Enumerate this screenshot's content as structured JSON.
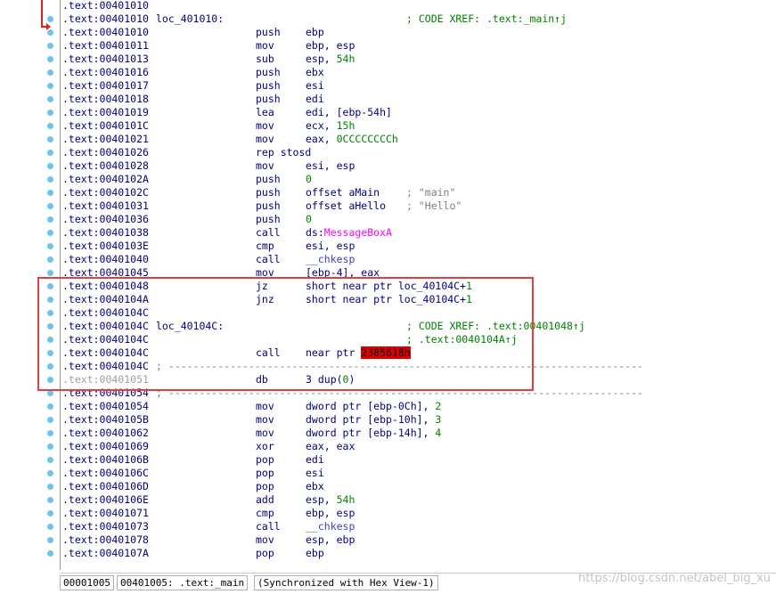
{
  "lines": [
    {
      "addr": ".text:00401010"
    },
    {
      "addr": ".text:00401010",
      "label": "loc_401010:",
      "comment": "; CODE XREF: .text:_main↑j"
    },
    {
      "addr": ".text:00401010",
      "mnem": "push",
      "ops": "ebp"
    },
    {
      "addr": ".text:00401011",
      "mnem": "mov",
      "ops": "ebp, esp"
    },
    {
      "addr": ".text:00401013",
      "mnem": "sub",
      "ops": "esp, ",
      "ops_num": "54h"
    },
    {
      "addr": ".text:00401016",
      "mnem": "push",
      "ops": "ebx"
    },
    {
      "addr": ".text:00401017",
      "mnem": "push",
      "ops": "esi"
    },
    {
      "addr": ".text:00401018",
      "mnem": "push",
      "ops": "edi"
    },
    {
      "addr": ".text:00401019",
      "mnem": "lea",
      "ops": "edi, [ebp-54h]"
    },
    {
      "addr": ".text:0040101C",
      "mnem": "mov",
      "ops": "ecx, ",
      "ops_num": "15h"
    },
    {
      "addr": ".text:00401021",
      "mnem": "mov",
      "ops": "eax, ",
      "ops_num": "0CCCCCCCCh"
    },
    {
      "addr": ".text:00401026",
      "mnem": "rep stosd"
    },
    {
      "addr": ".text:00401028",
      "mnem": "mov",
      "ops": "esi, esp"
    },
    {
      "addr": ".text:0040102A",
      "mnem": "push",
      "ops_num": "0"
    },
    {
      "addr": ".text:0040102C",
      "mnem": "push",
      "ops": "offset aMain",
      "str_comment": "; \"main\""
    },
    {
      "addr": ".text:00401031",
      "mnem": "push",
      "ops": "offset aHello",
      "str_comment": "; \"Hello\""
    },
    {
      "addr": ".text:00401036",
      "mnem": "push",
      "ops_num": "0"
    },
    {
      "addr": ".text:00401038",
      "mnem": "call",
      "ops": "ds:",
      "ops_imp": "MessageBoxA"
    },
    {
      "addr": ".text:0040103E",
      "mnem": "cmp",
      "ops": "esi, esp"
    },
    {
      "addr": ".text:00401040",
      "mnem": "call",
      "ops_lib": "__chkesp"
    },
    {
      "addr": ".text:00401045",
      "mnem": "mov",
      "ops": "[ebp-4], eax"
    },
    {
      "addr": ".text:00401048",
      "mnem": "jz",
      "ops": "short near ptr loc_40104C+",
      "ops_num": "1"
    },
    {
      "addr": ".text:0040104A",
      "mnem": "jnz",
      "ops": "short near ptr loc_40104C+",
      "ops_num": "1"
    },
    {
      "addr": ".text:0040104C"
    },
    {
      "addr": ".text:0040104C",
      "label": "loc_40104C:",
      "comment": "; CODE XREF: .text:00401048↑j"
    },
    {
      "addr": ".text:0040104C",
      "comment": "; .text:0040104A↑j"
    },
    {
      "addr": ".text:0040104C",
      "mnem": "call",
      "ops": "near ptr ",
      "ops_hl": "2385618h"
    },
    {
      "addr": ".text:0040104C",
      "separator": "; -----------------------------------------------------------------------------"
    },
    {
      "addr": ".text:00401051",
      "gray": true,
      "mnem": "db",
      "ops": "3 dup(",
      "ops_num": "0",
      "ops_tail": ")"
    },
    {
      "addr": ".text:00401054",
      "separator": "; -----------------------------------------------------------------------------"
    },
    {
      "addr": ".text:00401054",
      "mnem": "mov",
      "ops": "dword ptr [ebp-0Ch], ",
      "ops_num": "2"
    },
    {
      "addr": ".text:0040105B",
      "mnem": "mov",
      "ops": "dword ptr [ebp-10h], ",
      "ops_num": "3"
    },
    {
      "addr": ".text:00401062",
      "mnem": "mov",
      "ops": "dword ptr [ebp-14h], ",
      "ops_num": "4"
    },
    {
      "addr": ".text:00401069",
      "mnem": "xor",
      "ops": "eax, eax"
    },
    {
      "addr": ".text:0040106B",
      "mnem": "pop",
      "ops": "edi"
    },
    {
      "addr": ".text:0040106C",
      "mnem": "pop",
      "ops": "esi"
    },
    {
      "addr": ".text:0040106D",
      "mnem": "pop",
      "ops": "ebx"
    },
    {
      "addr": ".text:0040106E",
      "mnem": "add",
      "ops": "esp, ",
      "ops_num": "54h"
    },
    {
      "addr": ".text:00401071",
      "mnem": "cmp",
      "ops": "ebp, esp"
    },
    {
      "addr": ".text:00401073",
      "mnem": "call",
      "ops_lib": "__chkesp"
    },
    {
      "addr": ".text:00401078",
      "mnem": "mov",
      "ops": "esp, ebp"
    },
    {
      "addr": ".text:0040107A",
      "mnem": "pop",
      "ops": "ebp"
    }
  ],
  "status": {
    "offset": "00001005",
    "location": "00401005: .text:_main",
    "sync": "(Synchronized with Hex View-1)"
  },
  "watermark": "https://blog.csdn.net/abel_big_xu",
  "colors": {
    "arrow": "#e02020",
    "annotation_box": "#e04040",
    "highlight": "#e00000",
    "dot": "#6ec3ec"
  }
}
